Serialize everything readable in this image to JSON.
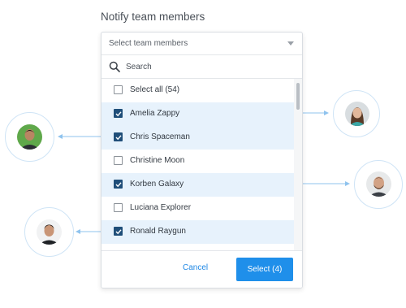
{
  "title": "Notify team members",
  "select": {
    "placeholder": "Select team members"
  },
  "search": {
    "placeholder": "Search",
    "value": ""
  },
  "select_all_label": "Select all (54)",
  "members": [
    {
      "label": "Amelia Zappy",
      "checked": true
    },
    {
      "label": "Chris Spaceman",
      "checked": true
    },
    {
      "label": "Christine Moon",
      "checked": false
    },
    {
      "label": "Korben Galaxy",
      "checked": true
    },
    {
      "label": "Luciana Explorer",
      "checked": false
    },
    {
      "label": "Ronald Raygun",
      "checked": true
    }
  ],
  "footer": {
    "cancel_label": "Cancel",
    "select_label": "Select (4)"
  },
  "colors": {
    "accent": "#1f8fea",
    "checkbox_checked": "#1f4e79",
    "row_highlight": "#e7f2fc",
    "connector": "#8fc3ee"
  },
  "avatars": [
    {
      "icon": "avatar-man-green-bg"
    },
    {
      "icon": "avatar-woman-long-hair"
    },
    {
      "icon": "avatar-man-beard"
    },
    {
      "icon": "avatar-man-dark-hair"
    }
  ]
}
